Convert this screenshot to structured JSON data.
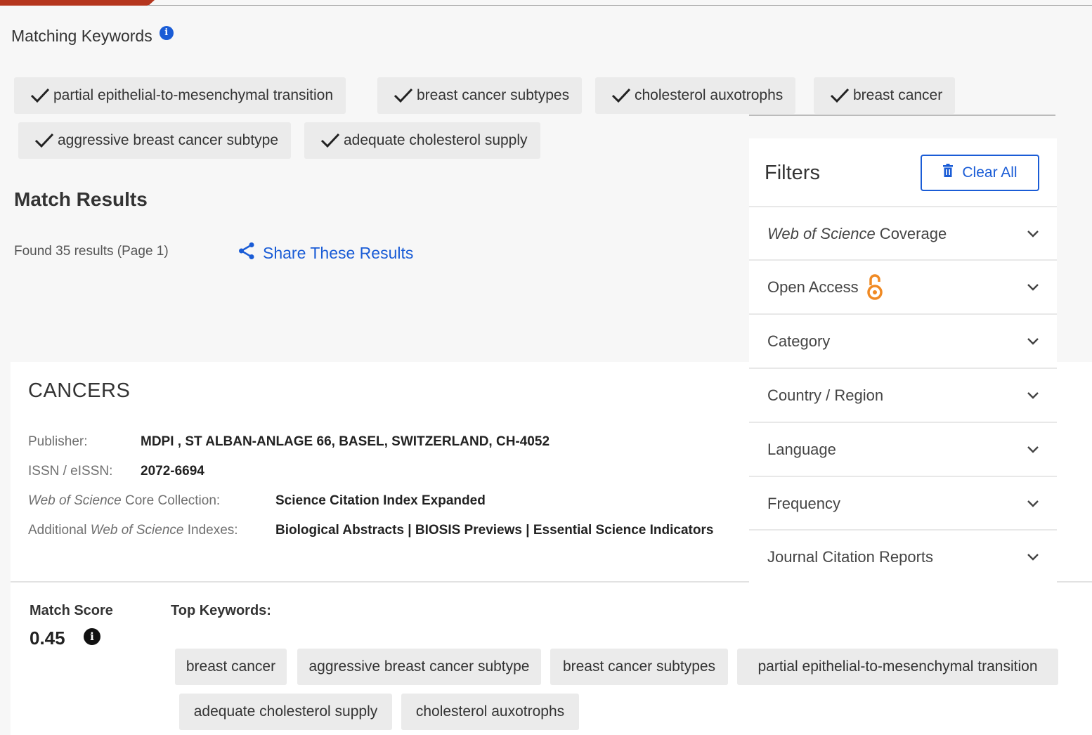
{
  "matching_keywords": {
    "title": "Matching Keywords",
    "info_icon": "info-circle-icon",
    "chips": [
      "partial epithelial-to-mesenchymal transition",
      "breast cancer subtypes",
      "cholesterol auxotrophs",
      "breast cancer",
      "aggressive breast cancer subtype",
      "adequate cholesterol supply"
    ]
  },
  "match_results": {
    "title": "Match Results",
    "found_text": "Found 35 results (Page 1)",
    "share_label": "Share These Results"
  },
  "filters": {
    "title": "Filters",
    "clear_label": "Clear All",
    "items": [
      {
        "prefix": "Web of Science",
        "label": " Coverage"
      },
      {
        "label": "Open Access"
      },
      {
        "label": "Category"
      },
      {
        "label": "Country / Region"
      },
      {
        "label": "Language"
      },
      {
        "label": "Frequency"
      },
      {
        "label": "Journal Citation Reports"
      }
    ]
  },
  "result": {
    "journal": "CANCERS",
    "publisher_label": "Publisher:",
    "publisher": "MDPI , ST ALBAN-ANLAGE 66, BASEL, SWITZERLAND, CH-4052",
    "issn_label": "ISSN / eISSN:",
    "issn": "2072-6694",
    "core_label_italic": "Web of Science",
    "core_label_rest": " Core Collection:",
    "core_value": "Science Citation Index Expanded",
    "addl_label_pre": "Additional ",
    "addl_label_italic": "Web of Science",
    "addl_label_post": " Indexes:",
    "addl_value": "Biological Abstracts | BIOSIS Previews | Essential Science Indicators",
    "match_score_label": "Match Score",
    "match_score": "0.45",
    "top_keywords_label": "Top Keywords:",
    "top_keywords": [
      "breast cancer",
      "aggressive breast cancer subtype",
      "breast cancer subtypes",
      "partial epithelial-to-mesenchymal transition",
      "adequate cholesterol supply",
      "cholesterol auxotrophs"
    ]
  },
  "colors": {
    "accent": "#1a5cd6",
    "brand_red": "#b5361e",
    "open_access_orange": "#f08a24"
  }
}
